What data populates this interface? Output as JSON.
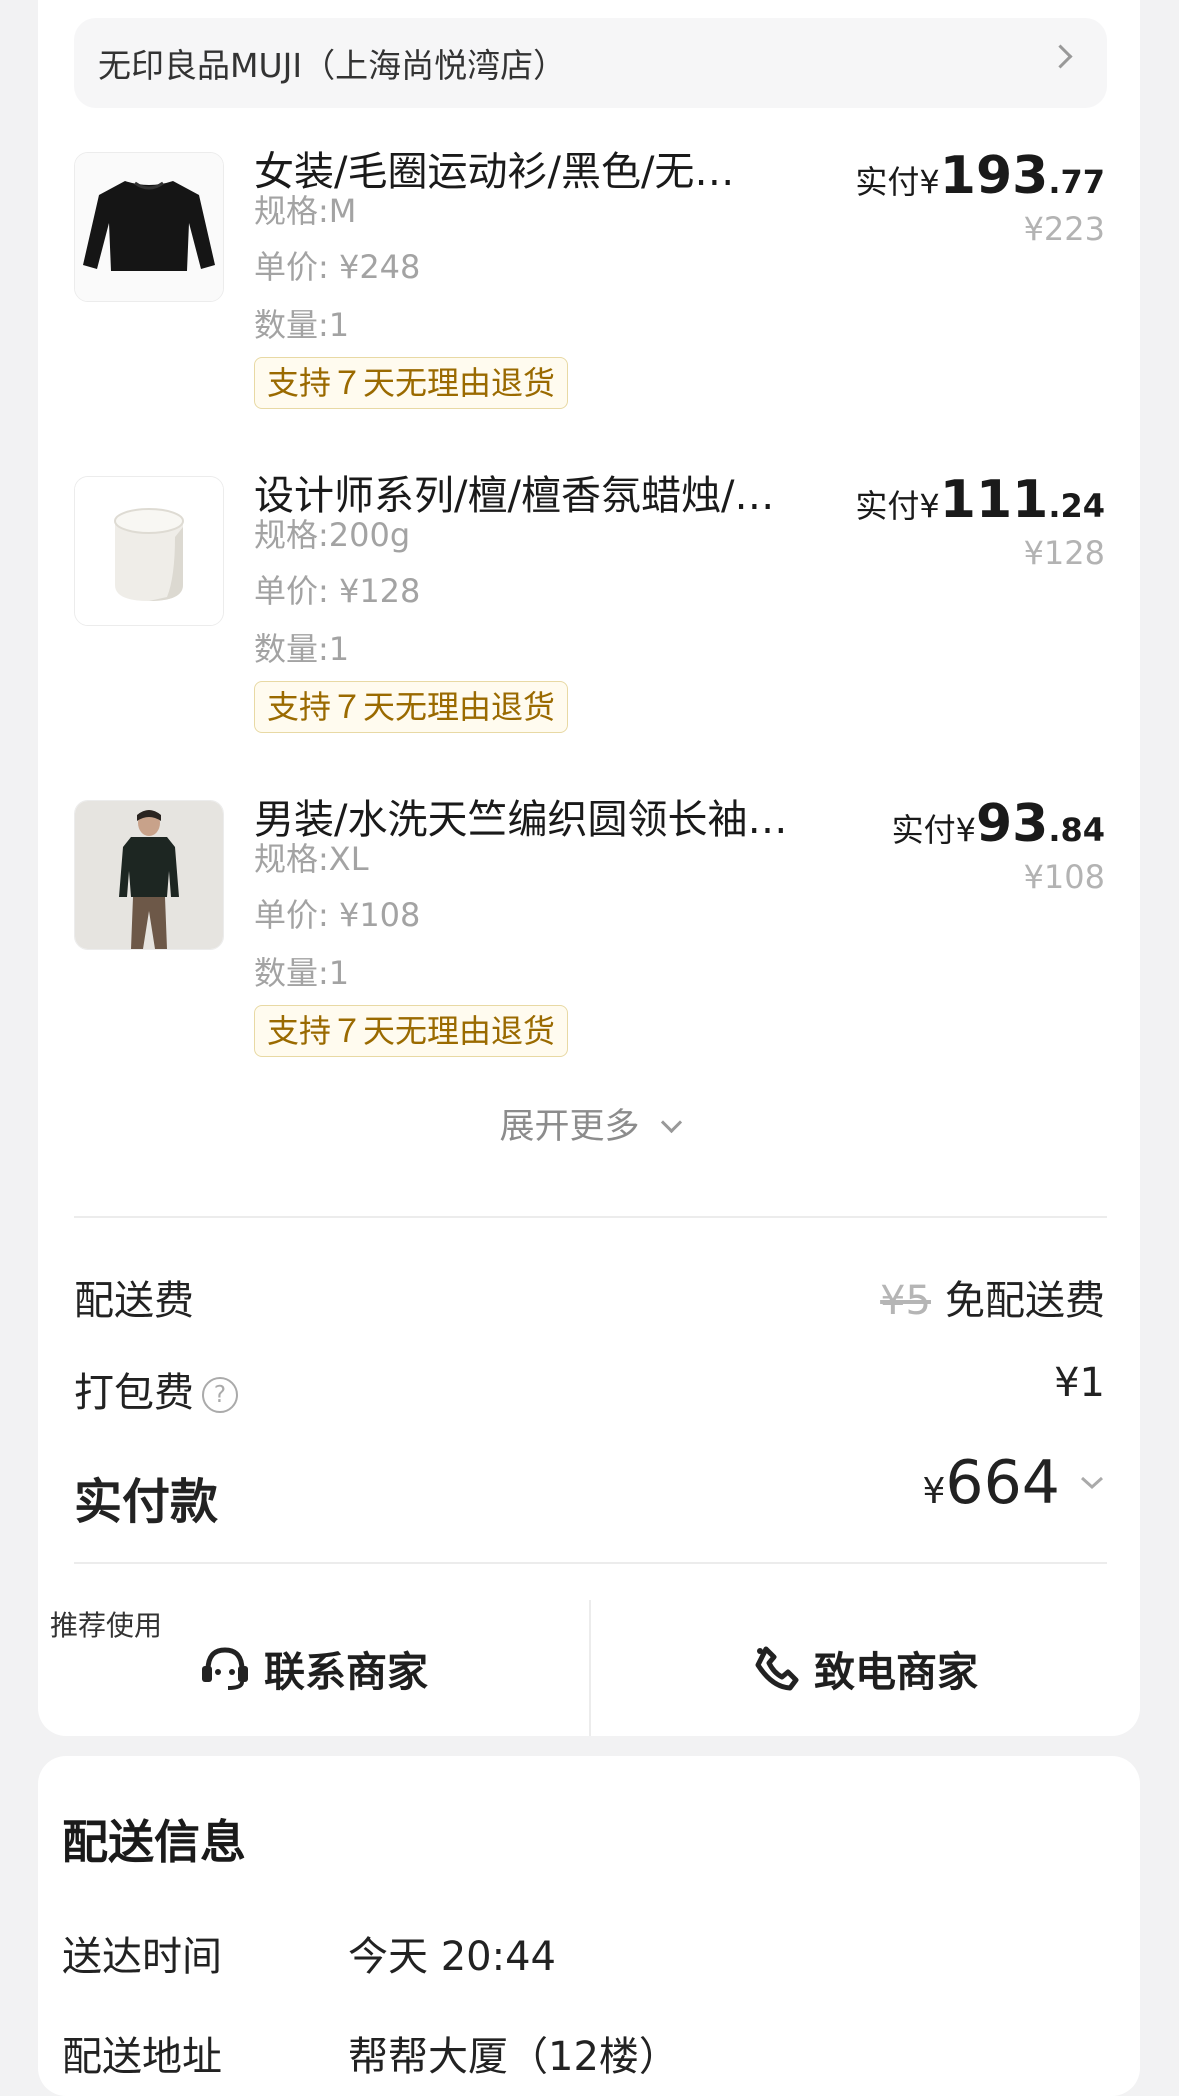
{
  "store": {
    "name": "无印良品MUJI（上海尚悦湾店）"
  },
  "items": [
    {
      "title": "女装/毛圈运动衫/黑色/无…",
      "spec": "规格:M",
      "unit_price": "单价: ¥248",
      "quantity": "数量:1",
      "tag": "支持７天无理由退货",
      "paid_label": "实付¥",
      "paid_int": "193",
      "paid_dec": ".77",
      "original_price": "¥223",
      "image": "black-sweatshirt"
    },
    {
      "title": "设计师系列/檀/檀香氛蜡烛/…",
      "spec": "规格:200g",
      "unit_price": "单价: ¥128",
      "quantity": "数量:1",
      "tag": "支持７天无理由退货",
      "paid_label": "实付¥",
      "paid_int": "111",
      "paid_dec": ".24",
      "original_price": "¥128",
      "image": "white-candle"
    },
    {
      "title": "男装/水洗天竺编织圆领长袖…",
      "spec": "规格:XL",
      "unit_price": "单价: ¥108",
      "quantity": "数量:1",
      "tag": "支持７天无理由退货",
      "paid_label": "实付¥",
      "paid_int": "93",
      "paid_dec": ".84",
      "original_price": "¥108",
      "image": "man-longsleeve"
    }
  ],
  "expand_label": "展开更多",
  "fees": {
    "delivery_label": "配送费",
    "delivery_original": "¥5",
    "delivery_value": "免配送费",
    "packing_label": "打包费",
    "packing_help": "?",
    "packing_value": "¥1",
    "total_label": "实付款",
    "total_currency": "¥",
    "total_value": "664"
  },
  "contact": {
    "recommend_badge": "推荐使用",
    "chat_label": "联系商家",
    "call_label": "致电商家"
  },
  "delivery": {
    "title": "配送信息",
    "time_label": "送达时间",
    "time_value": "今天 20:44",
    "address_label": "配送地址",
    "address_value": "帮帮大厦（12楼）"
  },
  "colors": {
    "background": "#f2f2f3",
    "card": "#ffffff",
    "tag_text": "#9a6a00",
    "tag_border": "#e8d9a4",
    "muted": "#a3a3a3"
  }
}
